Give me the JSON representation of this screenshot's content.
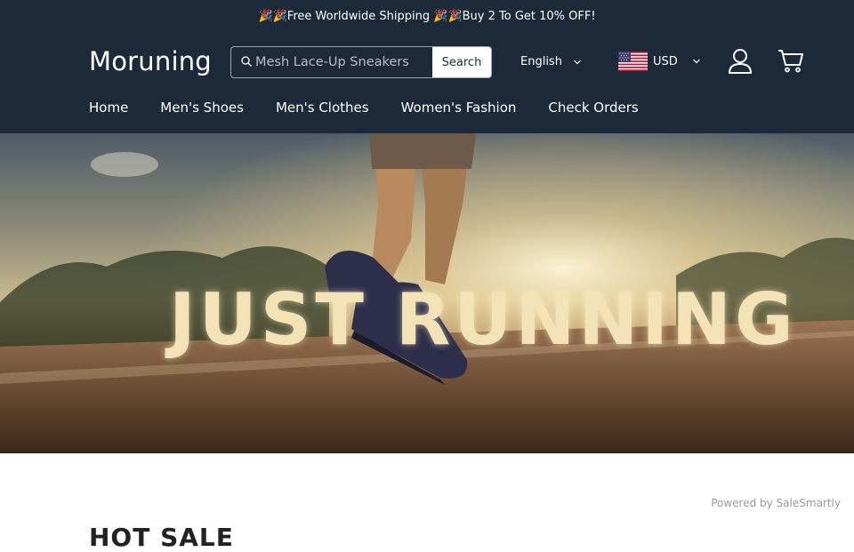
{
  "announcement": "🎉🎉Free Worldwide Shipping 🎉🎉Buy 2 To Get 10% OFF!",
  "header": {
    "logo": "Moruning",
    "search": {
      "placeholder": "Mesh Lace-Up Sneakers",
      "button": "Search"
    },
    "language": "English",
    "currency": "USD",
    "icons": {
      "search": "search-icon",
      "user": "user-icon",
      "cart": "cart-icon",
      "chevron": "chevron-down-icon",
      "flag": "us-flag-icon"
    }
  },
  "nav": {
    "items": [
      "Home",
      "Men's Shoes",
      "Men's Clothes",
      "Women's Fashion",
      "Check Orders"
    ]
  },
  "hero": {
    "text": "JUST RUNNING"
  },
  "footer": {
    "powered_by": "Powered by SaleSmartly"
  },
  "section": {
    "title": "HOT SALE"
  },
  "colors": {
    "header_bg": "#1b2938",
    "text_light": "#ffffff"
  }
}
